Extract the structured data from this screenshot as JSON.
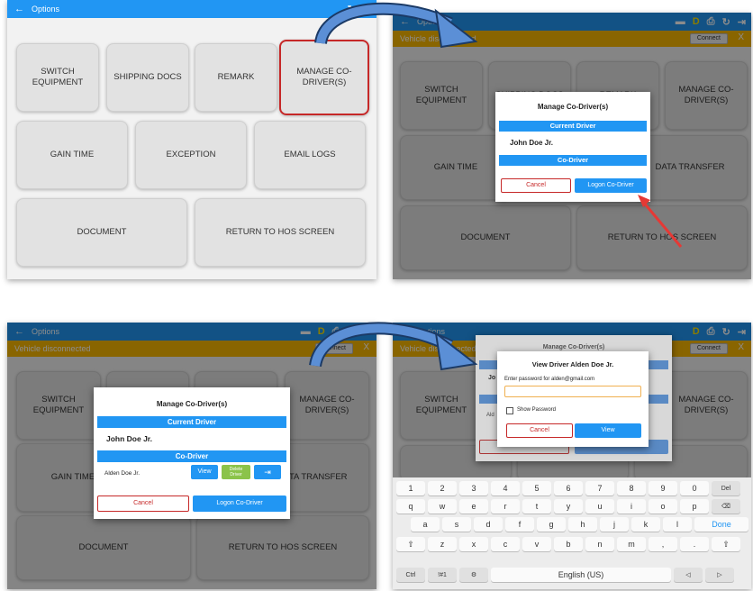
{
  "panel1": {
    "title": "Options",
    "icons": [
      "back-arrow-icon",
      "refresh-icon",
      "logout-icon"
    ],
    "tiles": {
      "switch_equipment": "SWITCH\nEQUIPMENT",
      "shipping_docs": "SHIPPING DOCS",
      "remark": "REMARK",
      "manage_codrivers": "MANAGE CO-\nDRIVER(S)",
      "gain_time": "GAIN TIME",
      "exception": "EXCEPTION",
      "email_logs": "EMAIL LOGS",
      "document": "DOCUMENT",
      "return_hos": "RETURN TO HOS SCREEN"
    }
  },
  "panel2": {
    "title": "Options",
    "vehicle_status": "Vehicle disconnected",
    "connect_label": "Connect",
    "close_label": "X",
    "status_letter": "D",
    "tiles": {
      "switch_equipment": "SWITCH\nEQUIPMENT",
      "shipping_docs": "SHIPPING DOCS",
      "remark": "REMARK",
      "manage_codrivers": "MANAGE CO-\nDRIVER(S)",
      "gain_time": "GAIN TIME",
      "data_transfer": "DATA TRANSFER",
      "document": "DOCUMENT",
      "return_hos": "RETURN TO HOS SCREEN"
    },
    "dialog": {
      "title": "Manage Co-Driver(s)",
      "current_driver_header": "Current Driver",
      "current_driver_name": "John Doe Jr.",
      "codriver_header": "Co-Driver",
      "cancel_label": "Cancel",
      "logon_label": "Logon Co-Driver"
    }
  },
  "panel3": {
    "title": "Options",
    "vehicle_status": "Vehicle disconnected",
    "connect_label": "Connect",
    "close_label": "X",
    "status_letter": "D",
    "tiles": {
      "switch_equipment": "SWITCH\nEQUIPMENT",
      "manage_codrivers": "MANAGE CO-\nDRIVER(S)",
      "gain_time": "GAIN TIME",
      "data_transfer": "DATA TRANSFER",
      "document": "DOCUMENT",
      "return_hos": "RETURN TO HOS SCREEN"
    },
    "dialog": {
      "title": "Manage Co-Driver(s)",
      "current_driver_header": "Current Driver",
      "current_driver_name": "John Doe Jr.",
      "codriver_header": "Co-Driver",
      "codriver_name": "Alden Doe Jr.",
      "view_label": "View",
      "delete_label": "Delete\nDriver",
      "cancel_label": "Cancel",
      "logon_label": "Logon Co-Driver"
    }
  },
  "panel4": {
    "title": "Options",
    "vehicle_status": "Vehicle disconnected",
    "connect_label": "Connect",
    "close_label": "X",
    "status_letter": "D",
    "tiles": {
      "switch_equipment": "SWITCH\nEQUIPMENT",
      "manage_codrivers": "MANAGE CO-\nDRIVER(S)"
    },
    "back_dialog_title": "Manage Co-Driver(s)",
    "back_dialog_name": "Jo",
    "back_dialog_codriver": "Ald",
    "dialog": {
      "title": "View Driver Alden Doe Jr.",
      "prompt": "Enter password for alden@gmail.com",
      "password_value": "",
      "show_password_label": "Show Password",
      "cancel_label": "Cancel",
      "view_label": "View"
    },
    "keyboard": {
      "row1": [
        "1",
        "2",
        "3",
        "4",
        "5",
        "6",
        "7",
        "8",
        "9",
        "0",
        "Del"
      ],
      "row2": [
        "q",
        "w",
        "e",
        "r",
        "t",
        "y",
        "u",
        "i",
        "o",
        "p",
        "⌫"
      ],
      "row3": [
        "a",
        "s",
        "d",
        "f",
        "g",
        "h",
        "j",
        "k",
        "l",
        "Done"
      ],
      "row4": [
        "⇧",
        "z",
        "x",
        "c",
        "v",
        "b",
        "n",
        "m",
        ",",
        ".",
        "⇧"
      ],
      "row5": [
        "Ctrl",
        "!#1",
        "⚙",
        "English (US)",
        "◁",
        "▷"
      ]
    }
  },
  "colors": {
    "accent": "#2196f3",
    "warning": "#f9b800",
    "danger": "#c62828",
    "success": "#8bc34a",
    "arrow": "#4a7fc1"
  }
}
